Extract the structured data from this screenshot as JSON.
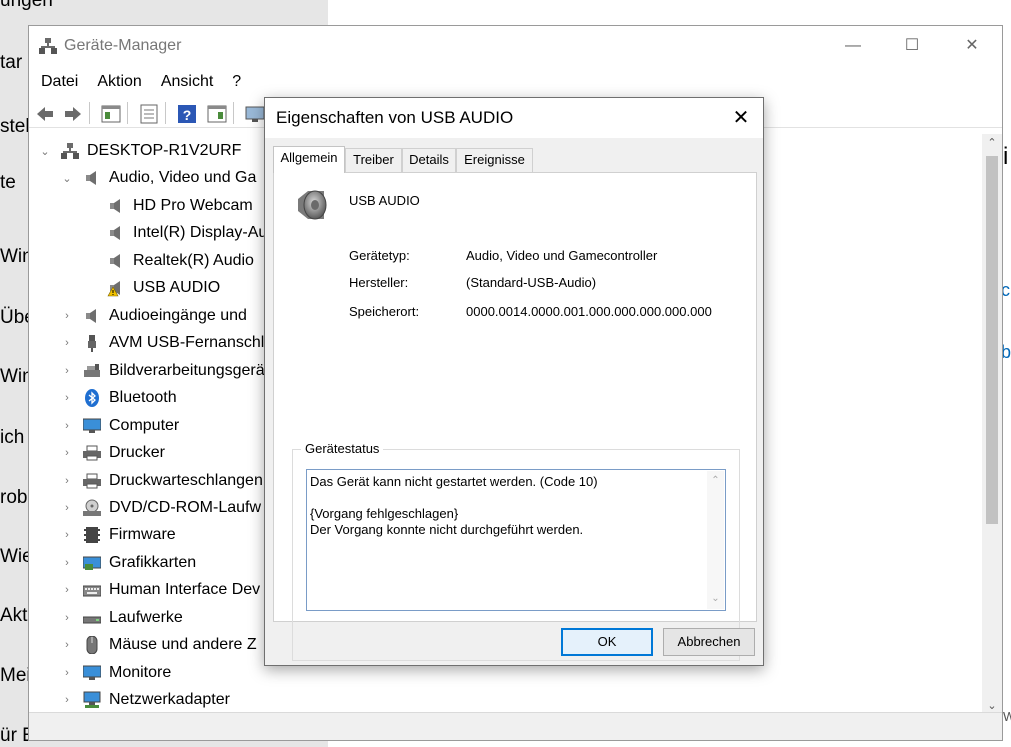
{
  "background": {
    "left_fragments": [
      "ungen",
      "tar",
      "stel",
      "te",
      "Win",
      "Übe",
      "Win",
      "ich",
      "rob",
      "Wie",
      "Akti",
      "Mei",
      "ür Entwickler"
    ],
    "right_fragments": [
      ":",
      "c",
      "be"
    ],
    "right_top_fragment": "i",
    "right_bottom_fragment": "W"
  },
  "device_manager": {
    "title": "Geräte-Manager",
    "menu": [
      "Datei",
      "Aktion",
      "Ansicht",
      "?"
    ],
    "tree": {
      "root": "DESKTOP-R1V2URF",
      "audio_category": "Audio, Video und Ga",
      "audio_children": [
        "HD Pro Webcam",
        "Intel(R) Display-Au",
        "Realtek(R) Audio",
        "USB  AUDIO"
      ],
      "categories": [
        "Audioeingänge und",
        "AVM USB-Fernanschl",
        "Bildverarbeitungsgerä",
        "Bluetooth",
        "Computer",
        "Drucker",
        "Druckwarteschlangen",
        "DVD/CD-ROM-Laufw",
        "Firmware",
        "Grafikkarten",
        "Human Interface Dev",
        "Laufwerke",
        "Mäuse und andere Z",
        "Monitore",
        "Netzwerkadapter"
      ]
    }
  },
  "dialog": {
    "title": "Eigenschaften von USB  AUDIO",
    "tabs": [
      "Allgemein",
      "Treiber",
      "Details",
      "Ereignisse"
    ],
    "device_name": "USB  AUDIO",
    "props": [
      {
        "label": "Gerätetyp:",
        "value": "Audio, Video und Gamecontroller"
      },
      {
        "label": "Hersteller:",
        "value": "(Standard-USB-Audio)"
      },
      {
        "label": "Speicherort:",
        "value": "0000.0014.0000.001.000.000.000.000.000"
      }
    ],
    "status_group_label": "Gerätestatus",
    "status_lines": [
      "Das Gerät kann nicht gestartet werden. (Code 10)",
      "",
      "{Vorgang fehlgeschlagen}",
      "Der Vorgang konnte nicht durchgeführt werden."
    ],
    "ok_label": "OK",
    "cancel_label": "Abbrechen"
  },
  "colors": {
    "accent": "#0078d7",
    "link": "#0067b8",
    "warning": "#f2c200"
  }
}
